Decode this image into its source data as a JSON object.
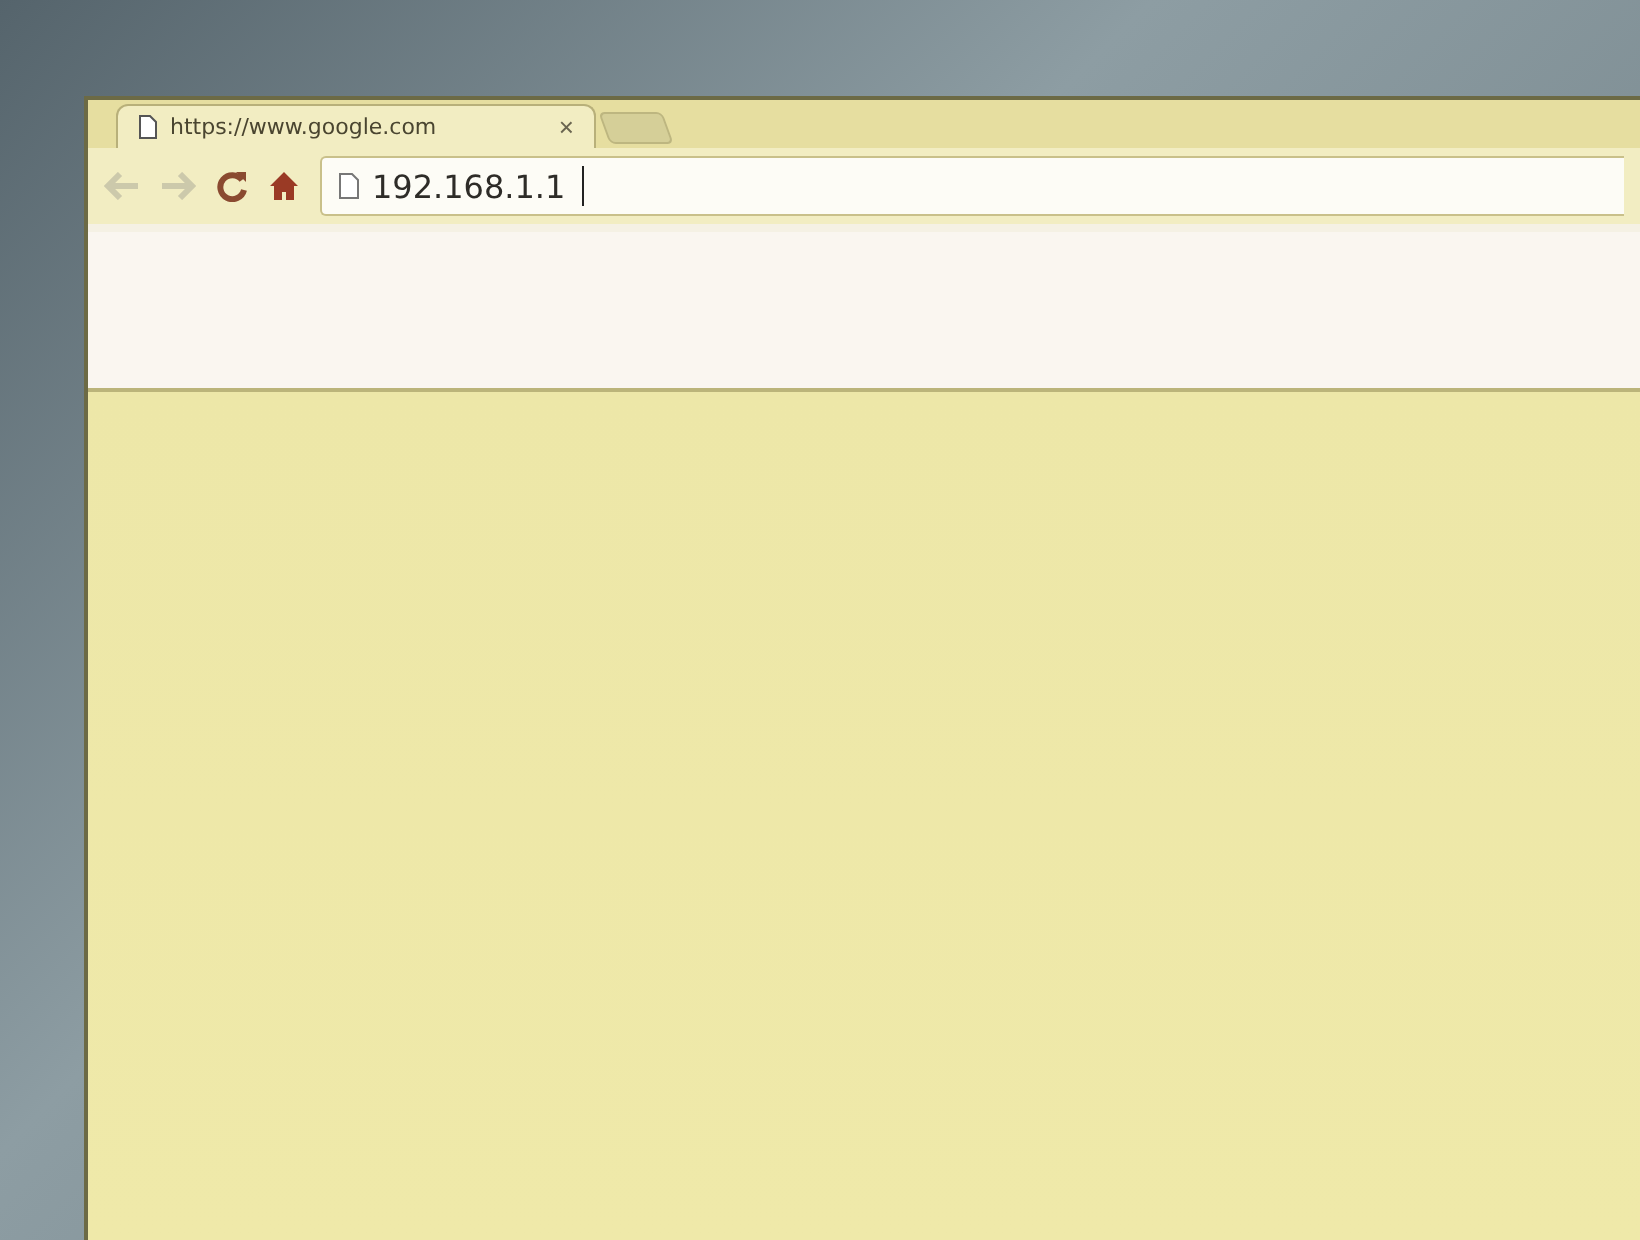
{
  "tabs": [
    {
      "title": "https://www.google.com",
      "close": "×",
      "selected": true
    }
  ],
  "toolbar": {
    "back_disabled": true,
    "forward_disabled": true
  },
  "address_bar": {
    "value": "192.168.1.1",
    "focused": true
  }
}
